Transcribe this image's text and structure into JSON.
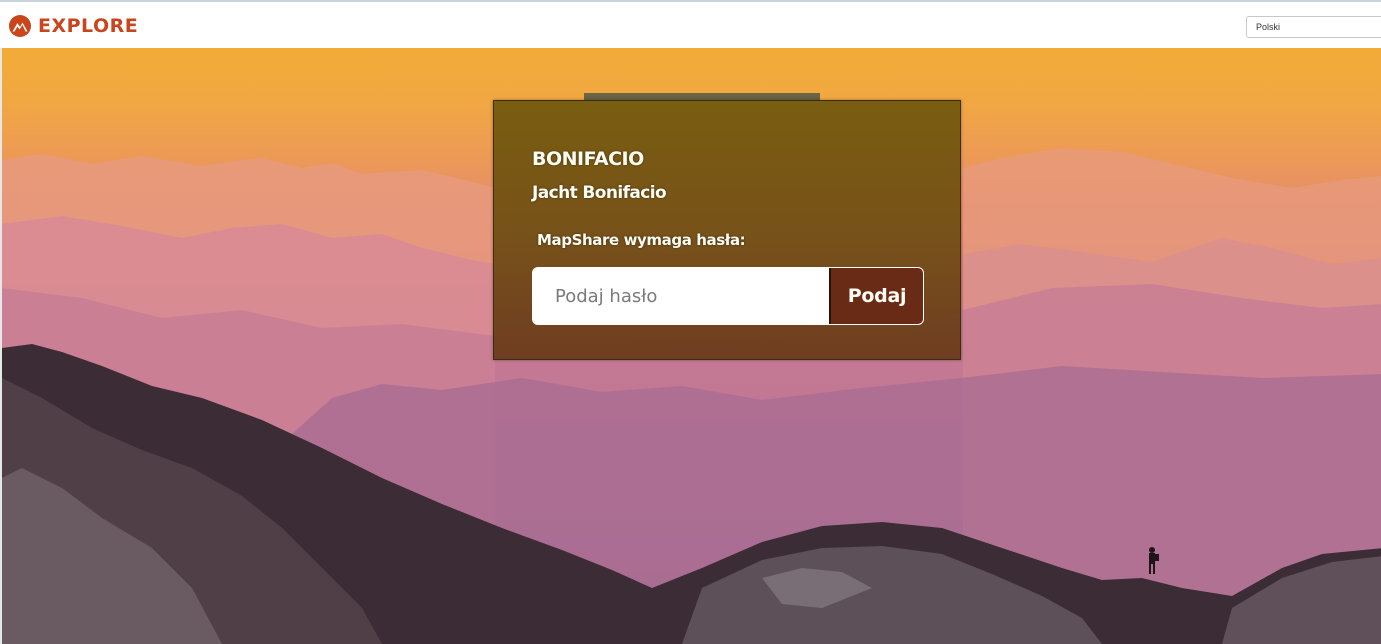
{
  "header": {
    "brand": "EXPLORE",
    "brand_icon": "explore-logo-icon",
    "language_select": {
      "selected": "Polski"
    }
  },
  "login_card": {
    "title": "BONIFACIO",
    "subtitle": "Jacht Bonifacio",
    "prompt": "MapShare wymaga hasła:",
    "password_input": {
      "placeholder": "Podaj hasło",
      "value": ""
    },
    "submit_label": "Podaj"
  },
  "colors": {
    "brand": "#c9461c",
    "card_background": "#70580c",
    "button_background": "#6a2b16"
  }
}
